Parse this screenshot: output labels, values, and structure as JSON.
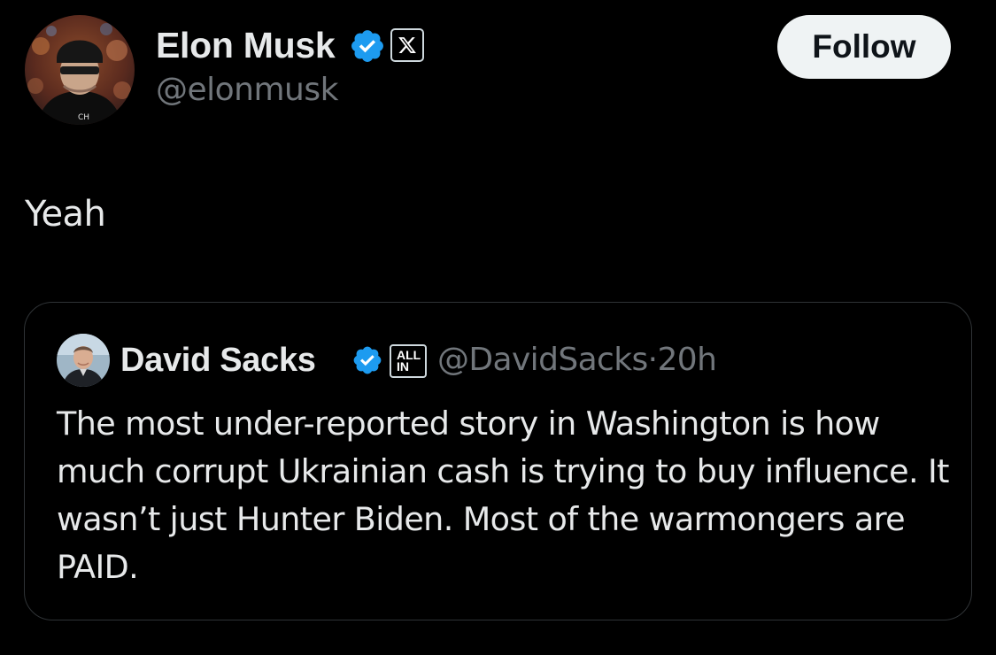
{
  "post": {
    "author": {
      "name": "Elon Musk",
      "handle": "@elonmusk",
      "verified": true,
      "affiliate_icon": "x-logo-icon",
      "avatar_icon": "user-avatar-photo"
    },
    "follow_label": "Follow",
    "text": "Yeah"
  },
  "quoted_post": {
    "author": {
      "name": "David Sacks",
      "handle": "@DavidSacks",
      "verified": true,
      "affiliate_badge": "ALL IN",
      "avatar_icon": "user-avatar-photo"
    },
    "separator": "·",
    "time": "20h",
    "text": "The most under-reported story in Washington is how much corrupt Ukrainian cash is trying to buy influence. It wasn’t just Hunter Biden. Most of the warmongers are PAID."
  },
  "colors": {
    "background": "#000000",
    "primary_text": "#e7e9ea",
    "secondary_text": "#71767b",
    "verified_blue": "#1d9bf0",
    "follow_button_bg": "#eff3f4",
    "follow_button_text": "#0f1419",
    "border": "#2f3336"
  }
}
